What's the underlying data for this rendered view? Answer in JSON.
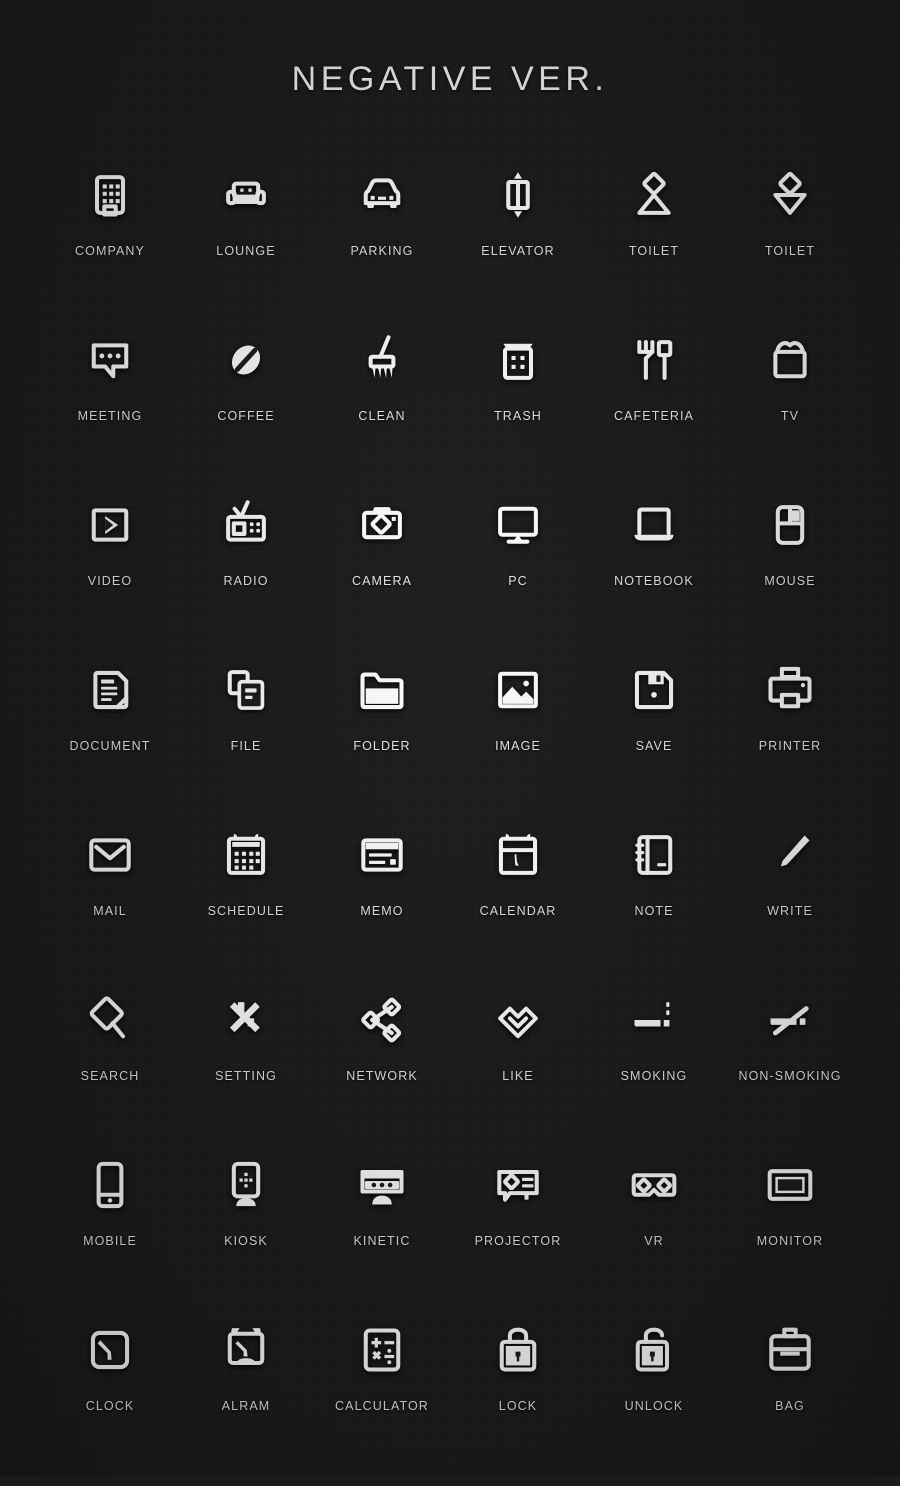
{
  "page": {
    "title": "NEGATIVE VER.",
    "background_color": "#1c1c1c",
    "icon_color": "#ffffff",
    "label_color": "#e9e9e9",
    "columns": 6,
    "rows": 8,
    "total_icons": 48
  },
  "icons": [
    {
      "label": "COMPANY",
      "name": "company-icon"
    },
    {
      "label": "LOUNGE",
      "name": "lounge-icon"
    },
    {
      "label": "PARKING",
      "name": "parking-icon"
    },
    {
      "label": "ELEVATOR",
      "name": "elevator-icon"
    },
    {
      "label": "TOILET",
      "name": "toilet-male-icon"
    },
    {
      "label": "TOILET",
      "name": "toilet-female-icon"
    },
    {
      "label": "MEETING",
      "name": "meeting-icon"
    },
    {
      "label": "COFFEE",
      "name": "coffee-icon"
    },
    {
      "label": "CLEAN",
      "name": "clean-icon"
    },
    {
      "label": "TRASH",
      "name": "trash-icon"
    },
    {
      "label": "CAFETERIA",
      "name": "cafeteria-icon"
    },
    {
      "label": "TV",
      "name": "tv-icon"
    },
    {
      "label": "VIDEO",
      "name": "video-icon"
    },
    {
      "label": "RADIO",
      "name": "radio-icon"
    },
    {
      "label": "CAMERA",
      "name": "camera-icon"
    },
    {
      "label": "PC",
      "name": "pc-icon"
    },
    {
      "label": "NOTEBOOK",
      "name": "notebook-icon"
    },
    {
      "label": "MOUSE",
      "name": "mouse-icon"
    },
    {
      "label": "DOCUMENT",
      "name": "document-icon"
    },
    {
      "label": "FILE",
      "name": "file-icon"
    },
    {
      "label": "FOLDER",
      "name": "folder-icon"
    },
    {
      "label": "IMAGE",
      "name": "image-icon"
    },
    {
      "label": "SAVE",
      "name": "save-icon"
    },
    {
      "label": "PRINTER",
      "name": "printer-icon"
    },
    {
      "label": "MAIL",
      "name": "mail-icon"
    },
    {
      "label": "SCHEDULE",
      "name": "schedule-icon"
    },
    {
      "label": "MEMO",
      "name": "memo-icon"
    },
    {
      "label": "CALENDAR",
      "name": "calendar-icon"
    },
    {
      "label": "NOTE",
      "name": "note-icon"
    },
    {
      "label": "WRITE",
      "name": "write-icon"
    },
    {
      "label": "SEARCH",
      "name": "search-icon"
    },
    {
      "label": "SETTING",
      "name": "setting-icon"
    },
    {
      "label": "NETWORK",
      "name": "network-icon"
    },
    {
      "label": "LIKE",
      "name": "like-icon"
    },
    {
      "label": "SMOKING",
      "name": "smoking-icon"
    },
    {
      "label": "NON-SMOKING",
      "name": "non-smoking-icon"
    },
    {
      "label": "MOBILE",
      "name": "mobile-icon"
    },
    {
      "label": "KIOSK",
      "name": "kiosk-icon"
    },
    {
      "label": "KINETIC",
      "name": "kinetic-icon"
    },
    {
      "label": "PROJECTOR",
      "name": "projector-icon"
    },
    {
      "label": "VR",
      "name": "vr-icon"
    },
    {
      "label": "MONITOR",
      "name": "monitor-icon"
    },
    {
      "label": "CLOCK",
      "name": "clock-icon"
    },
    {
      "label": "ALRAM",
      "name": "alarm-icon"
    },
    {
      "label": "CALCULATOR",
      "name": "calculator-icon"
    },
    {
      "label": "LOCK",
      "name": "lock-icon"
    },
    {
      "label": "UNLOCK",
      "name": "unlock-icon"
    },
    {
      "label": "BAG",
      "name": "bag-icon"
    }
  ]
}
